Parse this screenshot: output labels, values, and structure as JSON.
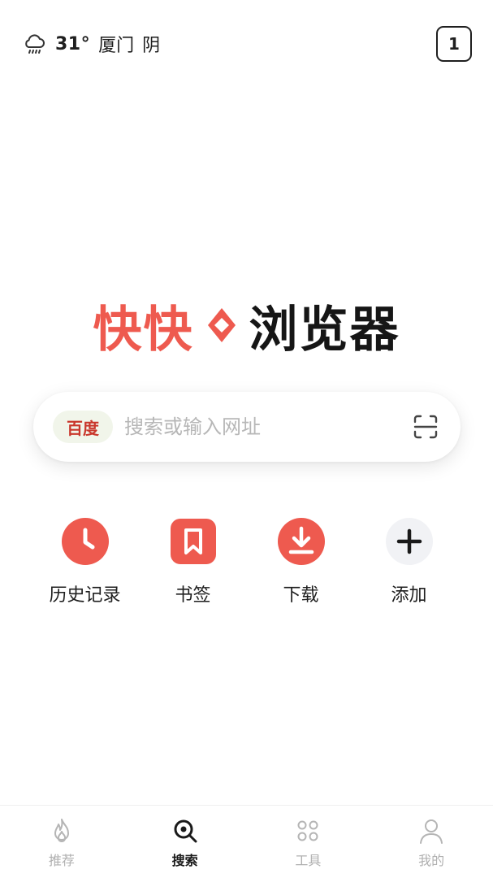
{
  "header": {
    "weather": {
      "temp": "31°",
      "city": "厦门",
      "condition": "阴",
      "icon": "rain-cloud-icon"
    },
    "tab_count": "1"
  },
  "logo": {
    "brand": "快快",
    "name": "浏览器",
    "accent": "#ee5a4f"
  },
  "search": {
    "engine": "百度",
    "placeholder": "搜索或输入网址",
    "value": ""
  },
  "quick_actions": [
    {
      "label": "历史记录",
      "icon": "clock-icon"
    },
    {
      "label": "书签",
      "icon": "bookmark-icon"
    },
    {
      "label": "下载",
      "icon": "download-icon"
    },
    {
      "label": "添加",
      "icon": "plus-icon"
    }
  ],
  "bottom_nav": [
    {
      "label": "推荐",
      "icon": "flame-icon",
      "active": false
    },
    {
      "label": "搜索",
      "icon": "search-icon",
      "active": true
    },
    {
      "label": "工具",
      "icon": "grid-icon",
      "active": false
    },
    {
      "label": "我的",
      "icon": "user-icon",
      "active": false
    }
  ]
}
